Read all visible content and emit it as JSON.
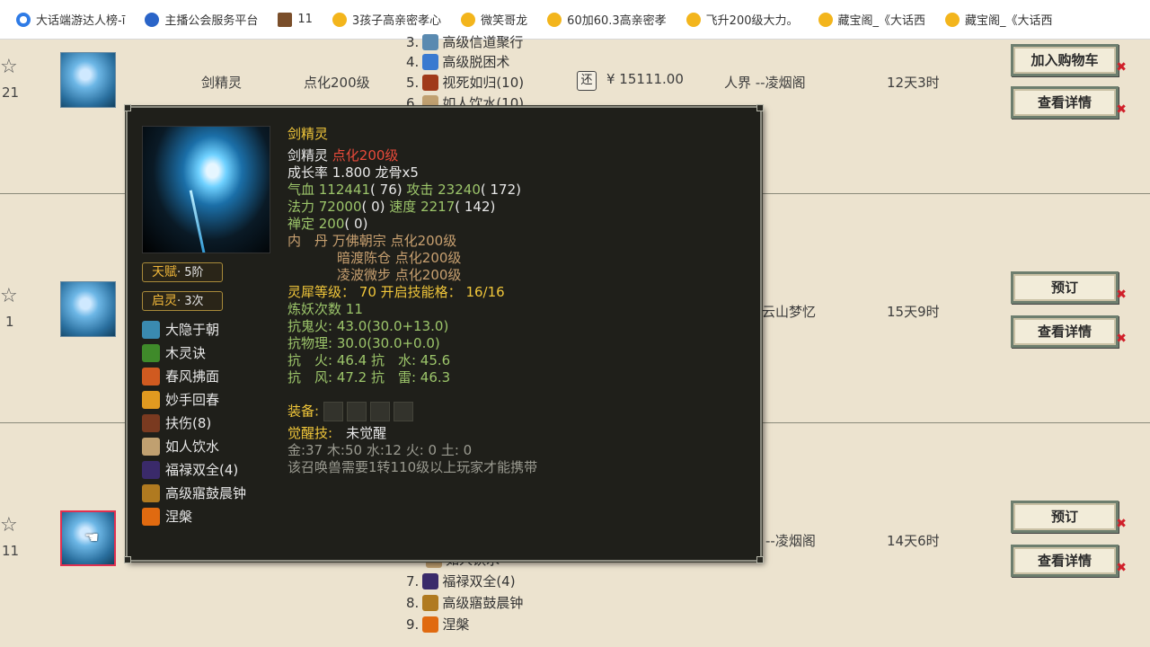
{
  "bookmarks": [
    {
      "label": "大话端游达人榜-ī",
      "icon": "edge-icon"
    },
    {
      "label": "主播公会服务平台",
      "icon": "globe-icon"
    },
    {
      "label": "11",
      "icon": "image-icon"
    },
    {
      "label": "3孩子高亲密孝心",
      "icon": "treasure-icon"
    },
    {
      "label": "微笑哥龙",
      "icon": "treasure-icon"
    },
    {
      "label": "60加60.3高亲密孝",
      "icon": "treasure-icon"
    },
    {
      "label": "飞升200级大力。",
      "icon": "treasure-icon"
    },
    {
      "label": "藏宝阁_《大话西",
      "icon": "treasure-icon"
    },
    {
      "label": "藏宝阁_《大话西",
      "icon": "treasure-icon"
    }
  ],
  "rows": [
    {
      "count": "21",
      "name": "剑精灵",
      "level": "点化200级",
      "skills": [
        {
          "num": "3.",
          "text": "高级信道聚行"
        },
        {
          "num": "4.",
          "text": "高级脱困术"
        },
        {
          "num": "5.",
          "text": "视死如归(10)"
        },
        {
          "num": "6.",
          "text": "如人饮水(10)"
        }
      ],
      "price_tag": "还",
      "price": "¥ 15111.00",
      "server": "人界 --凌烟阁",
      "time": "12天3时",
      "btn1": "加入购物车",
      "btn2": "查看详情"
    },
    {
      "count": "1",
      "server": "云山梦忆",
      "time": "15天9时",
      "btn1": "预订",
      "btn2": "查看详情"
    },
    {
      "count": "11",
      "skills": [
        {
          "num": "",
          "text": "如人饮水"
        },
        {
          "num": "7.",
          "text": "福禄双全(4)"
        },
        {
          "num": "8.",
          "text": "高级寤鼓晨钟"
        },
        {
          "num": "9.",
          "text": "涅槃"
        }
      ],
      "server": "--凌烟阁",
      "time": "14天6时",
      "btn1": "预订",
      "btn2": "查看详情"
    }
  ],
  "tooltip": {
    "name": "剑精灵",
    "subname": "剑精灵",
    "subname_level": "点化200级",
    "growth": "成长率 1.800 龙骨x5",
    "hp_label": "气血 112441",
    "hp_val": "( 76)",
    "atk_label": "攻击 23240",
    "atk_val": "( 172)",
    "mp_label": "法力 72000",
    "mp_val": "( 0)",
    "spd_label": "速度 2217",
    "spd_val": "( 142)",
    "def_label": "禅定 200",
    "def_val": "( 0)",
    "neidan_label": "内　丹",
    "neidan": [
      {
        "name": "万佛朝宗",
        "level": "点化200级"
      },
      {
        "name": "暗渡陈仓",
        "level": "点化200级"
      },
      {
        "name": "凌波微步",
        "level": "点化200级"
      }
    ],
    "lingxi_label": "灵犀等级：",
    "lingxi_val": "70",
    "lingxi_slots_label": "开启技能格：",
    "lingxi_slots_val": "16/16",
    "lianyao_label": "炼妖次数",
    "lianyao_val": "11",
    "resist1_label": "抗鬼火:",
    "resist1_val": "43.0(30.0+13.0)",
    "resist2_label": "抗物理:",
    "resist2_val": "30.0(30.0+0.0)",
    "resist3": "抗　火: 46.4 抗　水: 45.6",
    "resist4": "抗　风: 47.2 抗　雷: 46.3",
    "equip_label": "装备:",
    "awake_label": "觉醒技:",
    "awake_val": "未觉醒",
    "elements": "金:37 木:50 水:12 火: 0 土: 0",
    "note": "该召唤兽需要1转110级以上玩家才能携带",
    "talent_label": "天赋",
    "talent_val": "· 5阶",
    "qiling_label": "启灵",
    "qiling_val": "· 3次",
    "skills": [
      {
        "label": "大隐于朝",
        "color": "#3a8ab0"
      },
      {
        "label": "木灵诀",
        "color": "#3f8a2a"
      },
      {
        "label": "春风拂面",
        "color": "#d05a20"
      },
      {
        "label": "妙手回春",
        "color": "#e09a20"
      },
      {
        "label": "扶伤(8)",
        "color": "#7a3a20"
      },
      {
        "label": "如人饮水",
        "color": "#c0a070"
      },
      {
        "label": "福禄双全(4)",
        "color": "#3a2a6a"
      },
      {
        "label": "高级寤鼓晨钟",
        "color": "#b07a20"
      },
      {
        "label": "涅槃",
        "color": "#e06a10"
      }
    ]
  }
}
